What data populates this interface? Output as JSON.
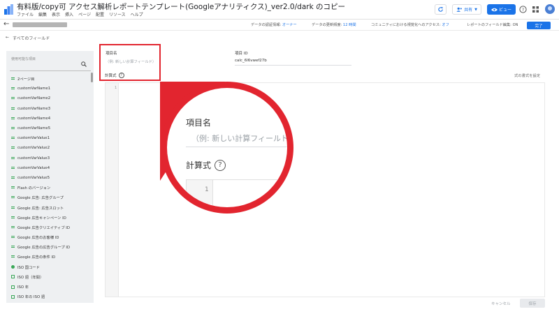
{
  "app": {
    "title": "有料版/copy可 アクセス解析レポートテンプレート(Googleアナリティクス)_ver2.0/dark のコピー",
    "menu": [
      "ファイル",
      "編集",
      "表示",
      "挿入",
      "ページ",
      "配置",
      "リソース",
      "ヘルプ"
    ],
    "share_label": "共有",
    "view_label": "ビュー"
  },
  "subbar": {
    "credentials_label": "データの認証情報:",
    "credentials_value": "オーナー",
    "freshness_label": "データの更新頻度:",
    "freshness_value": "12 時間",
    "community_label": "コミュニティにおける視覚化へのアクセス:",
    "community_value": "オフ",
    "field_edit_label": "レポートのフィールド編集:",
    "field_edit_value": "ON",
    "done_label": "完了"
  },
  "nav": {
    "all_fields": "すべてのフィールド"
  },
  "left_panel": {
    "header": "使用可能な項目",
    "fields": [
      {
        "label": "2ページ目",
        "icon": "abc"
      },
      {
        "label": "customVarName1",
        "icon": "abc"
      },
      {
        "label": "customVarName2",
        "icon": "abc"
      },
      {
        "label": "customVarName3",
        "icon": "abc"
      },
      {
        "label": "customVarName4",
        "icon": "abc"
      },
      {
        "label": "customVarName5",
        "icon": "abc"
      },
      {
        "label": "customVarValue1",
        "icon": "abc"
      },
      {
        "label": "customVarValue2",
        "icon": "abc"
      },
      {
        "label": "customVarValue3",
        "icon": "abc"
      },
      {
        "label": "customVarValue4",
        "icon": "abc"
      },
      {
        "label": "customVarValue5",
        "icon": "abc"
      },
      {
        "label": "Flash のバージョン",
        "icon": "abc"
      },
      {
        "label": "Google 広告: 広告グループ",
        "icon": "abc"
      },
      {
        "label": "Google 広告: 広告スロット",
        "icon": "abc"
      },
      {
        "label": "Google 広告キャンペーン ID",
        "icon": "abc"
      },
      {
        "label": "Google 広告クリエイティブ ID",
        "icon": "abc"
      },
      {
        "label": "Google 広告のお客様 ID",
        "icon": "abc"
      },
      {
        "label": "Google 広告の広告グループ ID",
        "icon": "abc"
      },
      {
        "label": "Google 広告の条件 ID",
        "icon": "abc"
      },
      {
        "label": "ISO 国コード",
        "icon": "geo"
      },
      {
        "label": "ISO 週（年間）",
        "icon": "cal"
      },
      {
        "label": "ISO 年",
        "icon": "cal"
      },
      {
        "label": "ISO 年の ISO 週",
        "icon": "cal"
      }
    ]
  },
  "form": {
    "name_label": "項目名",
    "name_placeholder": "（例: 新しい計算フィールド）",
    "id_label": "項目 ID",
    "id_value": "calc_6l6vwef27b",
    "formula_label": "計算式",
    "format_link": "式の書式を設定",
    "line_number": "1",
    "cancel_label": "キャンセル",
    "save_label": "保存"
  },
  "callout": {
    "name_label": "項目名",
    "name_placeholder": "（例: 新しい計算フィールド）",
    "formula_label": "計算式",
    "line_number": "1"
  },
  "colors": {
    "highlight": "#e2252f",
    "accent": "#1a73e8",
    "field_icon": "#3aa757"
  }
}
